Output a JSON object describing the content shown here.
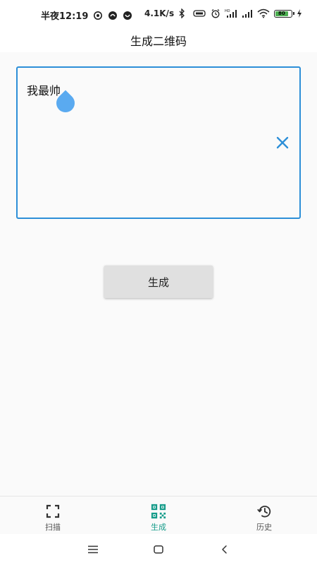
{
  "status_bar": {
    "time": "半夜12:19",
    "network_speed": "4.1K/s",
    "battery_level": "80",
    "battery_color": "#4caf50"
  },
  "header": {
    "title": "生成二维码"
  },
  "main": {
    "input_value": "我最帅",
    "accent_color": "#2d8fd8",
    "clear_icon": "close-icon",
    "generate_button_label": "生成"
  },
  "bottom_nav": {
    "active_color": "#169c8a",
    "items": [
      {
        "label": "扫描",
        "icon": "scan-icon"
      },
      {
        "label": "生成",
        "icon": "qr-code-icon"
      },
      {
        "label": "历史",
        "icon": "history-icon"
      }
    ]
  },
  "system_nav": {
    "icons": [
      "menu-icon",
      "home-icon",
      "back-icon"
    ]
  }
}
